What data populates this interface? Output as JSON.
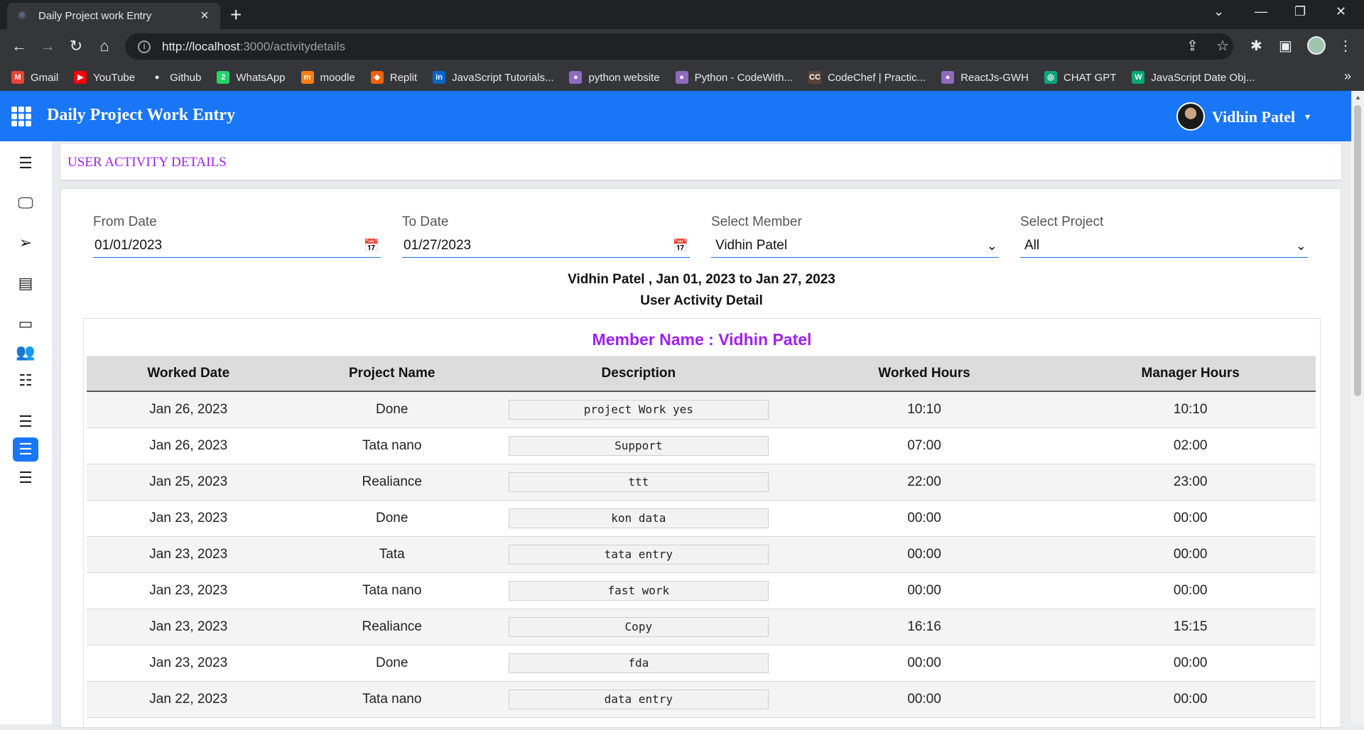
{
  "browser": {
    "tab_title": "Daily Project work Entry",
    "url_host": "http://localhost",
    "url_rest": ":3000/activitydetails",
    "bookmarks": [
      {
        "label": "Gmail",
        "color": "#ea4335",
        "glyph": "M"
      },
      {
        "label": "YouTube",
        "color": "#ff0000",
        "glyph": "▶"
      },
      {
        "label": "Github",
        "color": "#ffffff",
        "glyph": "●"
      },
      {
        "label": "WhatsApp",
        "color": "#25d366",
        "glyph": "2"
      },
      {
        "label": "moodle",
        "color": "#f98012",
        "glyph": "m"
      },
      {
        "label": "Replit",
        "color": "#f26207",
        "glyph": "◆"
      },
      {
        "label": "JavaScript Tutorials...",
        "color": "#0a66c2",
        "glyph": "in"
      },
      {
        "label": "python website",
        "color": "#8e6bbf",
        "glyph": "●"
      },
      {
        "label": "Python - CodeWith...",
        "color": "#8e6bbf",
        "glyph": "●"
      },
      {
        "label": "CodeChef | Practic...",
        "color": "#5b4638",
        "glyph": "CC"
      },
      {
        "label": "ReactJs-GWH",
        "color": "#8e6bbf",
        "glyph": "●"
      },
      {
        "label": "CHAT GPT",
        "color": "#10a37f",
        "glyph": "◎"
      },
      {
        "label": "JavaScript Date Obj...",
        "color": "#04aa6d",
        "glyph": "W"
      }
    ]
  },
  "app": {
    "title": "Daily Project Work Entry",
    "user_name": "Vidhin Patel",
    "breadcrumb": "USER ACTIVITY DETAILS"
  },
  "filters": {
    "from_label": "From Date",
    "from_value": "01/01/2023",
    "to_label": "To Date",
    "to_value": "01/27/2023",
    "member_label": "Select Member",
    "member_value": "Vidhin Patel",
    "project_label": "Select Project",
    "project_value": "All"
  },
  "summary": {
    "line1": "Vidhin Patel , Jan 01, 2023 to Jan 27, 2023",
    "line2": "User Activity Detail"
  },
  "table": {
    "member_title": "Member Name : Vidhin Patel",
    "headers": [
      "Worked Date",
      "Project Name",
      "Description",
      "Worked Hours",
      "Manager Hours"
    ],
    "rows": [
      [
        "Jan 26, 2023",
        "Done",
        "project Work yes",
        "10:10",
        "10:10"
      ],
      [
        "Jan 26, 2023",
        "Tata nano",
        "Support",
        "07:00",
        "02:00"
      ],
      [
        "Jan 25, 2023",
        "Realiance",
        "ttt",
        "22:00",
        "23:00"
      ],
      [
        "Jan 23, 2023",
        "Done",
        "kon data",
        "00:00",
        "00:00"
      ],
      [
        "Jan 23, 2023",
        "Tata",
        "tata entry",
        "00:00",
        "00:00"
      ],
      [
        "Jan 23, 2023",
        "Tata nano",
        "fast work",
        "00:00",
        "00:00"
      ],
      [
        "Jan 23, 2023",
        "Realiance",
        "Copy",
        "16:16",
        "15:15"
      ],
      [
        "Jan 23, 2023",
        "Done",
        "fda",
        "00:00",
        "00:00"
      ],
      [
        "Jan 22, 2023",
        "Tata nano",
        "data entry",
        "00:00",
        "00:00"
      ]
    ]
  }
}
